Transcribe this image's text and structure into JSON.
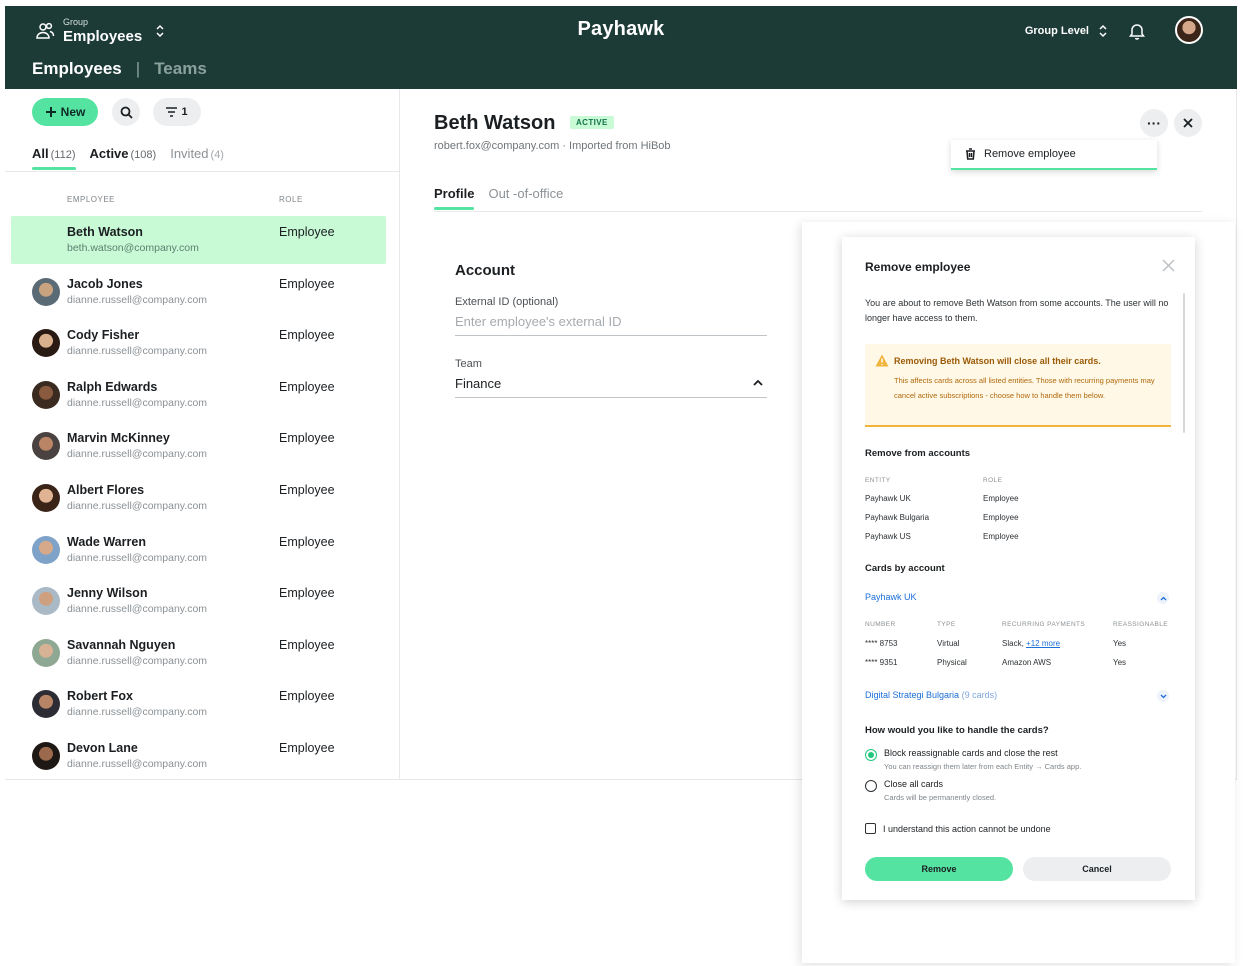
{
  "topbar": {
    "group_label": "Group",
    "group_value": "Employees",
    "brand": "Payhawk",
    "level": "Group Level",
    "tabs": [
      {
        "label": "Employees"
      },
      {
        "label": "Teams"
      }
    ],
    "tab_separator": "|"
  },
  "toolbar": {
    "new_label": "New",
    "filter_count": "1"
  },
  "filters": [
    {
      "label": "All",
      "count": "(112)"
    },
    {
      "label": "Active",
      "count": "(108)"
    },
    {
      "label": "Invited",
      "count": "(4)"
    }
  ],
  "columns": {
    "employee": "EMPLOYEE",
    "role": "ROLE"
  },
  "employees": [
    {
      "name": "Beth Watson",
      "email": "beth.watson@company.com",
      "role": "Employee"
    },
    {
      "name": "Jacob Jones",
      "email": "dianne.russell@company.com",
      "role": "Employee"
    },
    {
      "name": "Cody Fisher",
      "email": "dianne.russell@company.com",
      "role": "Employee"
    },
    {
      "name": "Ralph Edwards",
      "email": "dianne.russell@company.com",
      "role": "Employee"
    },
    {
      "name": "Marvin McKinney",
      "email": "dianne.russell@company.com",
      "role": "Employee"
    },
    {
      "name": "Albert Flores",
      "email": "dianne.russell@company.com",
      "role": "Employee"
    },
    {
      "name": "Wade Warren",
      "email": "dianne.russell@company.com",
      "role": "Employee"
    },
    {
      "name": "Jenny Wilson",
      "email": "dianne.russell@company.com",
      "role": "Employee"
    },
    {
      "name": "Savannah Nguyen",
      "email": "dianne.russell@company.com",
      "role": "Employee"
    },
    {
      "name": "Robert Fox",
      "email": "dianne.russell@company.com",
      "role": "Employee"
    },
    {
      "name": "Devon Lane",
      "email": "dianne.russell@company.com",
      "role": "Employee"
    }
  ],
  "detail": {
    "name": "Beth Watson",
    "status": "ACTIVE",
    "subtitle": "robert.fox@company.com · Imported from HiBob",
    "more_label": "···",
    "menu_item": "Remove employee",
    "tabs": [
      {
        "label": "Profile"
      },
      {
        "label": "Out -of-office"
      }
    ],
    "account_title": "Account",
    "external_id_label": "External ID (optional)",
    "external_id_placeholder": "Enter employee's external ID",
    "team_label": "Team",
    "team_value": "Finance"
  },
  "modal": {
    "title": "Remove employee",
    "description": "You are about to remove Beth Watson from some accounts. The user will no longer have access to them.",
    "warning_title": "Removing Beth Watson will close all their cards.",
    "warning_text": "This affects cards across all listed entities. Those with recurring payments may cancel active subscriptions - choose how to handle them below.",
    "remove_from_title": "Remove from accounts",
    "accounts_head": {
      "entity": "ENTITY",
      "role": "ROLE"
    },
    "accounts": [
      {
        "entity": "Payhawk UK",
        "role": "Employee"
      },
      {
        "entity": "Payhawk Bulgaria",
        "role": "Employee"
      },
      {
        "entity": "Payhawk US",
        "role": "Employee"
      }
    ],
    "cards_title": "Cards by account",
    "account_expanded": "Payhawk UK",
    "cards_head": {
      "number": "NUMBER",
      "type": "TYPE",
      "recurring": "RECURRING PAYMENTS",
      "reassignable": "REASSIGNABLE"
    },
    "cards": [
      {
        "number": "**** 8753",
        "type": "Virtual",
        "recurring": "Slack,",
        "recurring_more": "+12 more",
        "reassignable": "Yes"
      },
      {
        "number": "**** 9351",
        "type": "Physical",
        "recurring": "Amazon AWS",
        "recurring_more": "",
        "reassignable": "Yes"
      }
    ],
    "account_collapsed": "Digital Strategi Bulgaria",
    "account_collapsed_count": "(9 cards)",
    "question": "How would you like to handle the cards?",
    "options": [
      {
        "label": "Block reassignable cards and close the rest",
        "hint": "You can reassign them later from each Entity → Cards app."
      },
      {
        "label": "Close all cards",
        "hint": "Cards will be permanently closed."
      }
    ],
    "confirm_label": "I understand this action cannot be undone",
    "remove_button": "Remove",
    "cancel_button": "Cancel"
  },
  "colors": {
    "topbar": "#1c3a36",
    "accent": "#54e3a1",
    "selected_row": "#c8fad5",
    "warning_bg": "#fff8e6",
    "link": "#1b6fd8"
  }
}
